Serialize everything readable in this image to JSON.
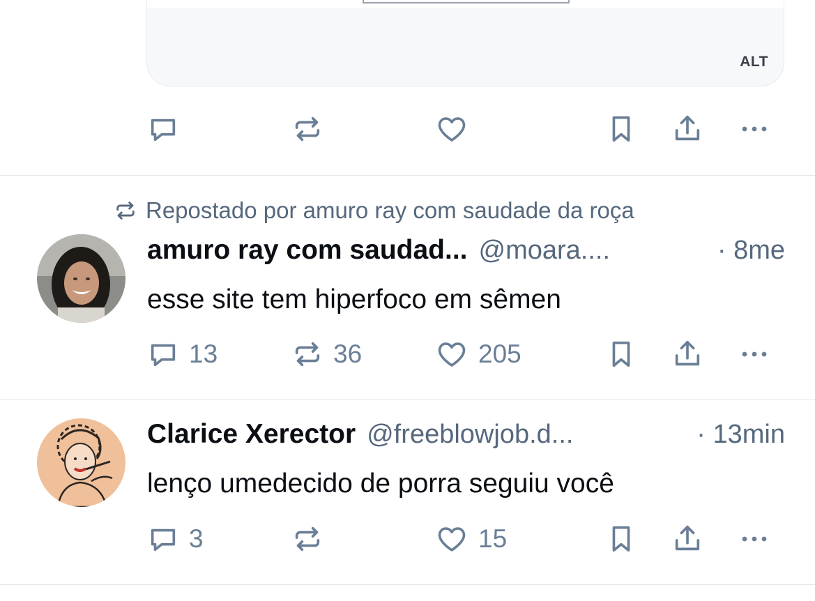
{
  "post1": {
    "alt_badge": "ALT"
  },
  "post2": {
    "repost_label": "Repostado por amuro ray com saudade da roça",
    "display_name": "amuro ray com saudad...",
    "handle": "@moara....",
    "time": "· 8me",
    "text": "esse site tem hiperfoco em sêmen",
    "replies": "13",
    "reposts": "36",
    "likes": "205"
  },
  "post3": {
    "display_name": "Clarice Xerector",
    "handle": "@freeblowjob.d...",
    "time": "· 13min",
    "text": "lenço umedecido de porra seguiu você",
    "replies": "3",
    "reposts": "",
    "likes": "15"
  },
  "icons": {
    "reply": "speech-bubble-icon",
    "repost": "repost-arrows-icon",
    "like": "heart-icon",
    "bookmark": "bookmark-icon",
    "share": "share-upload-icon",
    "more": "ellipsis-icon"
  },
  "colors": {
    "icon": "#6a7e96",
    "secondary_text": "#56687d",
    "primary_text": "#0b0f14",
    "divider": "#e3e7eb"
  }
}
